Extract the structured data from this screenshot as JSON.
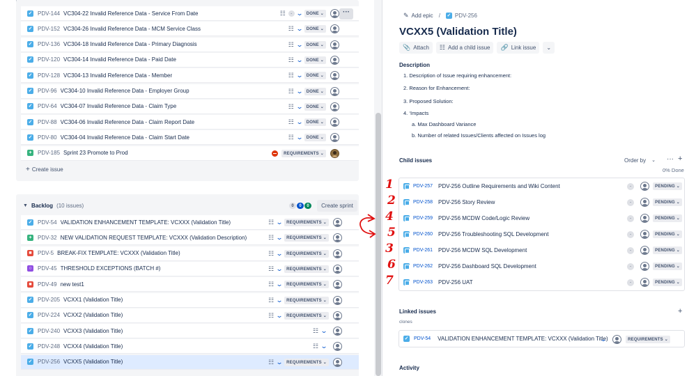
{
  "sprint": {
    "issues": [
      {
        "key": "PDV-144",
        "summary": "VC304-22 Invalid Reference Data - Service From Date",
        "type": "story",
        "status": "DONE"
      },
      {
        "key": "PDV-152",
        "summary": "VC304-26 Invalid Reference Data - MCM Service Class",
        "type": "story",
        "status": "DONE"
      },
      {
        "key": "PDV-136",
        "summary": "VC304-18 Invalid Reference Data - Primary Diagnosis",
        "type": "story",
        "status": "DONE"
      },
      {
        "key": "PDV-120",
        "summary": "VC304-14 Invalid Reference Data - Paid Date",
        "type": "story",
        "status": "DONE"
      },
      {
        "key": "PDV-128",
        "summary": "VC304-13 Invalid Reference Data - Member",
        "type": "story",
        "status": "DONE"
      },
      {
        "key": "PDV-96",
        "summary": "VC304-10 Invalid Reference Data - Employer Group",
        "type": "story",
        "status": "DONE"
      },
      {
        "key": "PDV-64",
        "summary": "VC304-07 Invalid Reference Data - Claim Type",
        "type": "story",
        "status": "DONE"
      },
      {
        "key": "PDV-88",
        "summary": "VC304-06 Invalid Reference Data - Claim Report Date",
        "type": "story",
        "status": "DONE"
      },
      {
        "key": "PDV-80",
        "summary": "VC304-04 Invalid Reference Data - Claim Start Date",
        "type": "story",
        "status": "DONE"
      },
      {
        "key": "PDV-185",
        "summary": "Sprint 23 Promote to Prod",
        "type": "new-feature",
        "status": "REQUIREMENTS"
      }
    ],
    "priority_badge": "-",
    "create_issue_label": "Create issue"
  },
  "backlog": {
    "title": "Backlog",
    "count_label": "(10 issues)",
    "counts": [
      {
        "value": "0",
        "color": "#dfe1e6",
        "text_color": "#42526e"
      },
      {
        "value": "0",
        "color": "#0052cc",
        "text_color": "#ffffff"
      },
      {
        "value": "0",
        "color": "#00875a",
        "text_color": "#ffffff"
      }
    ],
    "create_sprint_label": "Create sprint",
    "issues": [
      {
        "key": "PDV-54",
        "summary": "VALIDATION ENHANCEMENT TEMPLATE: VCXXX (Validation Title)",
        "type": "story",
        "status": "REQUIREMENTS"
      },
      {
        "key": "PDV-32",
        "summary": "NEW VALIDATION REQUEST TEMPLATE: VCXXX (Validation Description)",
        "type": "new-feature",
        "status": "REQUIREMENTS"
      },
      {
        "key": "PDV-5",
        "summary": "BREAK-FIX TEMPLATE: VCXXX (Validation Title)",
        "type": "bug",
        "status": "REQUIREMENTS"
      },
      {
        "key": "PDV-45",
        "summary": "THRESHOLD EXCEPTIONS (BATCH #)",
        "type": "threshold",
        "status": "REQUIREMENTS"
      },
      {
        "key": "PDV-49",
        "summary": "new test1",
        "type": "bug",
        "status": "REQUIREMENTS"
      },
      {
        "key": "PDV-205",
        "summary": "VCXX1 (Validation Title)",
        "type": "story",
        "status": "REQUIREMENTS"
      },
      {
        "key": "PDV-224",
        "summary": "VCXX2 (Validation Title)",
        "type": "story",
        "status": "REQUIREMENTS"
      },
      {
        "key": "PDV-240",
        "summary": "VCXX3 (Validation Title)",
        "type": "story",
        "status": ""
      },
      {
        "key": "PDV-248",
        "summary": "VCXX4 (Validation Title)",
        "type": "story",
        "status": ""
      },
      {
        "key": "PDV-256",
        "summary": "VCXX5 (Validation Title)",
        "type": "story",
        "status": "REQUIREMENTS"
      }
    ]
  },
  "detail": {
    "add_epic_label": "Add epic",
    "breadcrumb_sep": "/",
    "issue_key": "PDV-256",
    "title": "VCXX5 (Validation Title)",
    "actions": {
      "attach": "Attach",
      "add_child": "Add a child issue",
      "link_issue": "Link issue"
    },
    "description_label": "Description",
    "description_items": [
      "1.  Description of Issue requiring enhancement:",
      "2.  Reason for Enhancement:",
      "3.  Proposed Solution:",
      "4.  ‘Impacts",
      "a.  Max Dashboard Variance",
      "b.  Number of related Issues/Clients affected on Issues log"
    ],
    "child_issues_label": "Child issues",
    "order_by_label": "Order by",
    "done_label": "0% Done",
    "child_issues": [
      {
        "key": "PDV-257",
        "summary": "PDV-256 Outline Requirements and Wiki Content",
        "status": "PENDING"
      },
      {
        "key": "PDV-258",
        "summary": "PDV-256 Story Review",
        "status": "PENDING"
      },
      {
        "key": "PDV-259",
        "summary": "PDV-256 MCDW Code/Logic Review",
        "status": "PENDING"
      },
      {
        "key": "PDV-260",
        "summary": "PDV-256 Troubleshooting SQL Development",
        "status": "PENDING"
      },
      {
        "key": "PDV-261",
        "summary": "PDV-256 MCDW SQL Development",
        "status": "PENDING"
      },
      {
        "key": "PDV-262",
        "summary": "PDV-256 Dashboard SQL Development",
        "status": "PENDING"
      },
      {
        "key": "PDV-263",
        "summary": "PDV-256 UAT",
        "status": "PENDING"
      }
    ],
    "linked_issues_label": "Linked issues",
    "link_type": "clones",
    "linked_issue": {
      "key": "PDV-54",
      "summary": "VALIDATION ENHANCEMENT TEMPLATE: VCXXX (Validation Title)",
      "status": "REQUIREMENTS"
    },
    "activity_label": "Activity"
  },
  "annotations": {
    "numbers": [
      "1",
      "2",
      "4",
      "5",
      "3",
      "6",
      "7"
    ],
    "color": "#e01010"
  },
  "colors": {
    "story": "#36b37e",
    "story_check": "#4bade8",
    "bug": "#e5493a",
    "new_feature": "#36b37e",
    "threshold": "#904ee2",
    "selected_row": "#deebff",
    "link": "#0052cc"
  },
  "icons": {
    "story": "check-square-icon",
    "bug": "bug-square-icon",
    "new_feature": "plus-square-icon",
    "threshold": "circle-square-icon",
    "hierarchy": "hierarchy-icon",
    "priority": "chevron-down-icon",
    "avatar": "user-avatar-icon"
  }
}
